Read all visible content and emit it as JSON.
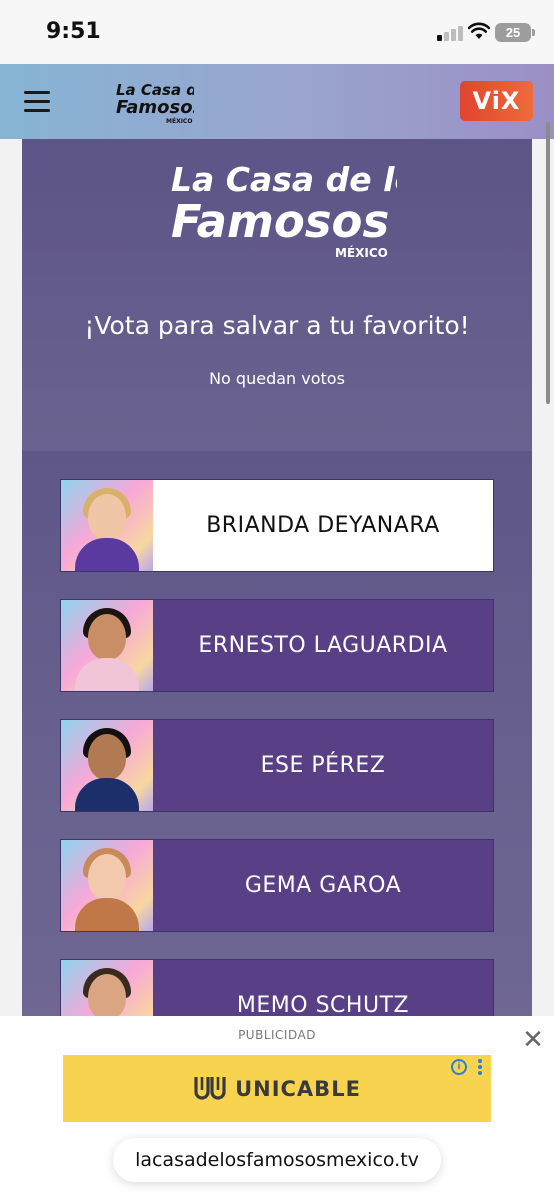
{
  "status_bar": {
    "time": "9:51",
    "battery": "25"
  },
  "header": {
    "logo_lines": [
      "La Casa de los",
      "Famosos",
      "MÉXICO"
    ],
    "vix_label": "ViX",
    "menu_icon": "hamburger-menu-icon"
  },
  "hero": {
    "logo_lines": [
      "La Casa de los",
      "Famosos",
      "MÉXICO"
    ],
    "title": "¡Vota para salvar a tu favorito!",
    "subtitle": "No quedan votos"
  },
  "candidates": [
    {
      "name": "BRIANDA DEYANARA",
      "selected": true
    },
    {
      "name": "ERNESTO LAGUARDIA",
      "selected": false
    },
    {
      "name": "ESE PÉREZ",
      "selected": false
    },
    {
      "name": "GEMA GAROA",
      "selected": false
    },
    {
      "name": "MEMO SCHUTZ",
      "selected": false
    }
  ],
  "ad": {
    "label": "PUBLICIDAD",
    "close_icon": "close-icon",
    "brand": "UNICABLE",
    "info_icon": "info-icon",
    "info_glyph": "i"
  },
  "browser": {
    "url": "lacasadelosfamososmexico.tv"
  },
  "colors": {
    "header_start": "#86b4d4",
    "header_end": "#9b8fc6",
    "panel": "#6b6290",
    "candidate": "#583f86",
    "selected": "#ffffff",
    "ad_yellow": "#f7d34f",
    "vix": "#e0442e"
  }
}
